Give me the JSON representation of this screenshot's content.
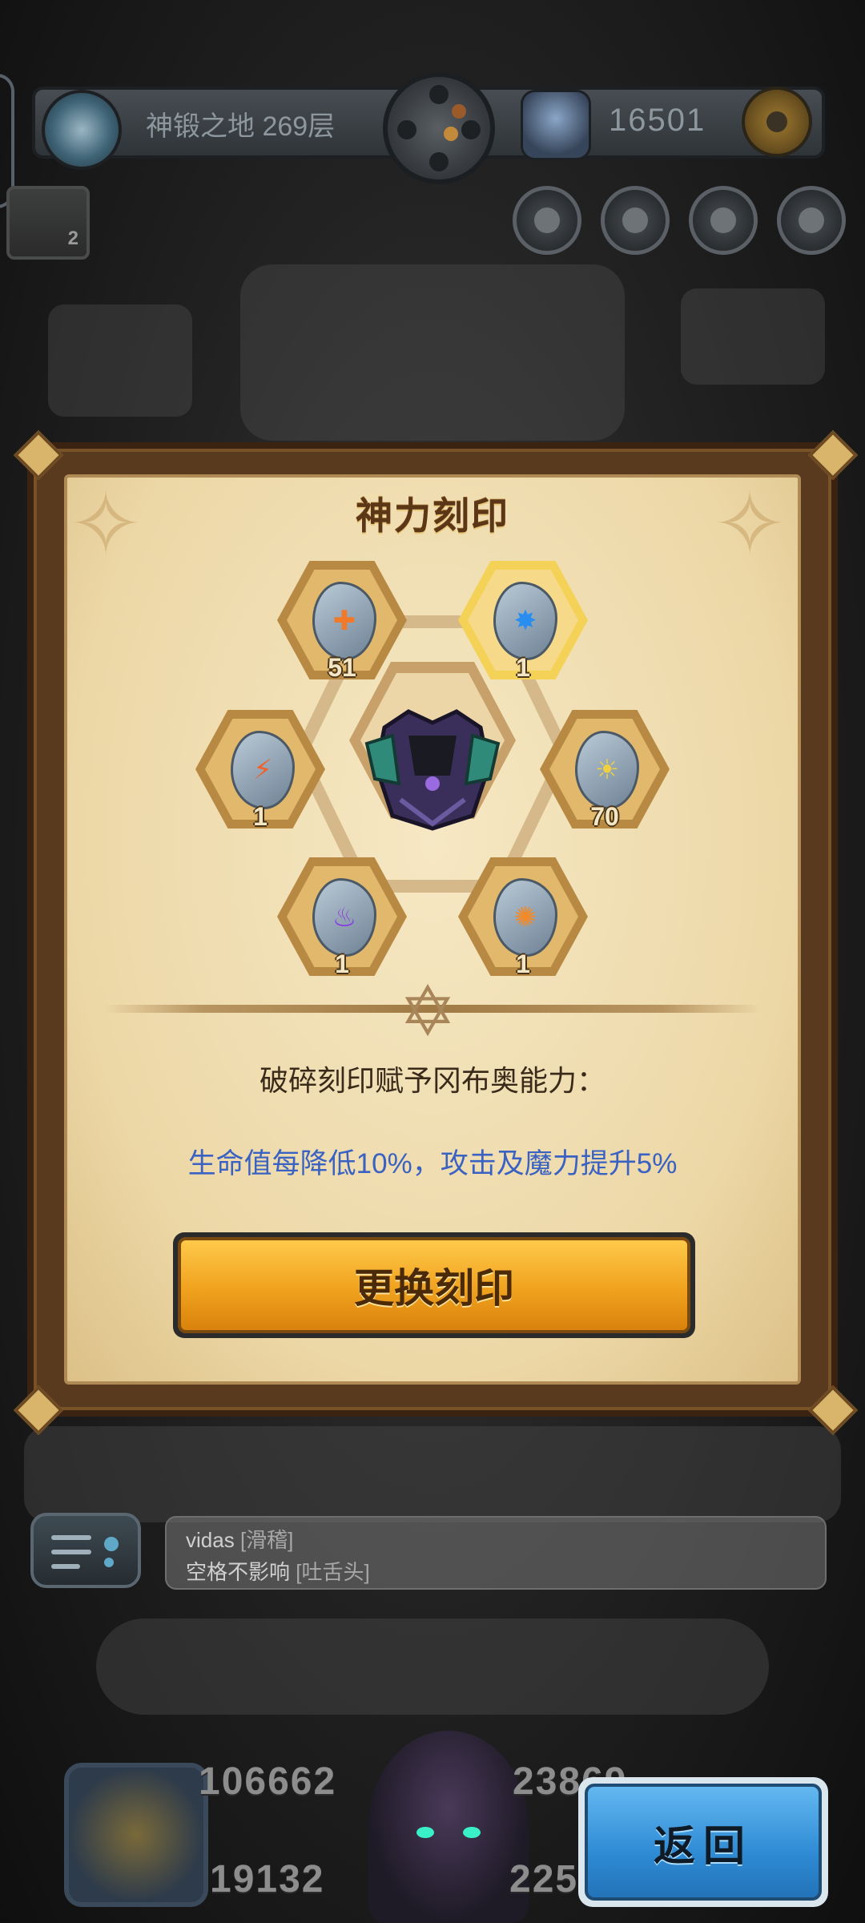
{
  "header": {
    "floor_label": "神锻之地 269层",
    "currency_value": "16501",
    "badge_count": "2"
  },
  "modal": {
    "title": "神力刻印",
    "runes": [
      {
        "count": "51",
        "icon": "orange-cross-rune",
        "color": "#f07a2a",
        "selected": false
      },
      {
        "count": "1",
        "icon": "blue-star-rune",
        "color": "#2a8ef0",
        "selected": true
      },
      {
        "count": "1",
        "icon": "orange-crack-rune",
        "color": "#f0602a",
        "selected": false
      },
      {
        "count": "70",
        "icon": "yellow-sun-rune",
        "color": "#f0d040",
        "selected": false
      },
      {
        "count": "1",
        "icon": "purple-flame-rune",
        "color": "#8a3ae0",
        "selected": false
      },
      {
        "count": "1",
        "icon": "orange-swirl-rune",
        "color": "#f08a2a",
        "selected": false
      }
    ],
    "ability_label": "破碎刻印赋予冈布奥能力：",
    "ability_desc": "生命值每降低10%，攻击及魔力提升5%",
    "swap_button": "更换刻印"
  },
  "chat": {
    "user": "vidas",
    "user_emote": "[滑稽]",
    "message": "空格不影响",
    "message_emote": "[吐舌头]"
  },
  "bottom": {
    "stat_top_left": "106662",
    "stat_bottom_left": "19132",
    "stat_top_right": "23869",
    "stat_bottom_right": "225",
    "back_button": "返回"
  },
  "colors": {
    "ability_desc": "#3a62c2",
    "swap_button": "#f0a21e",
    "back_button": "#2f8bd4",
    "modal_frame": "#5a3a1e"
  }
}
